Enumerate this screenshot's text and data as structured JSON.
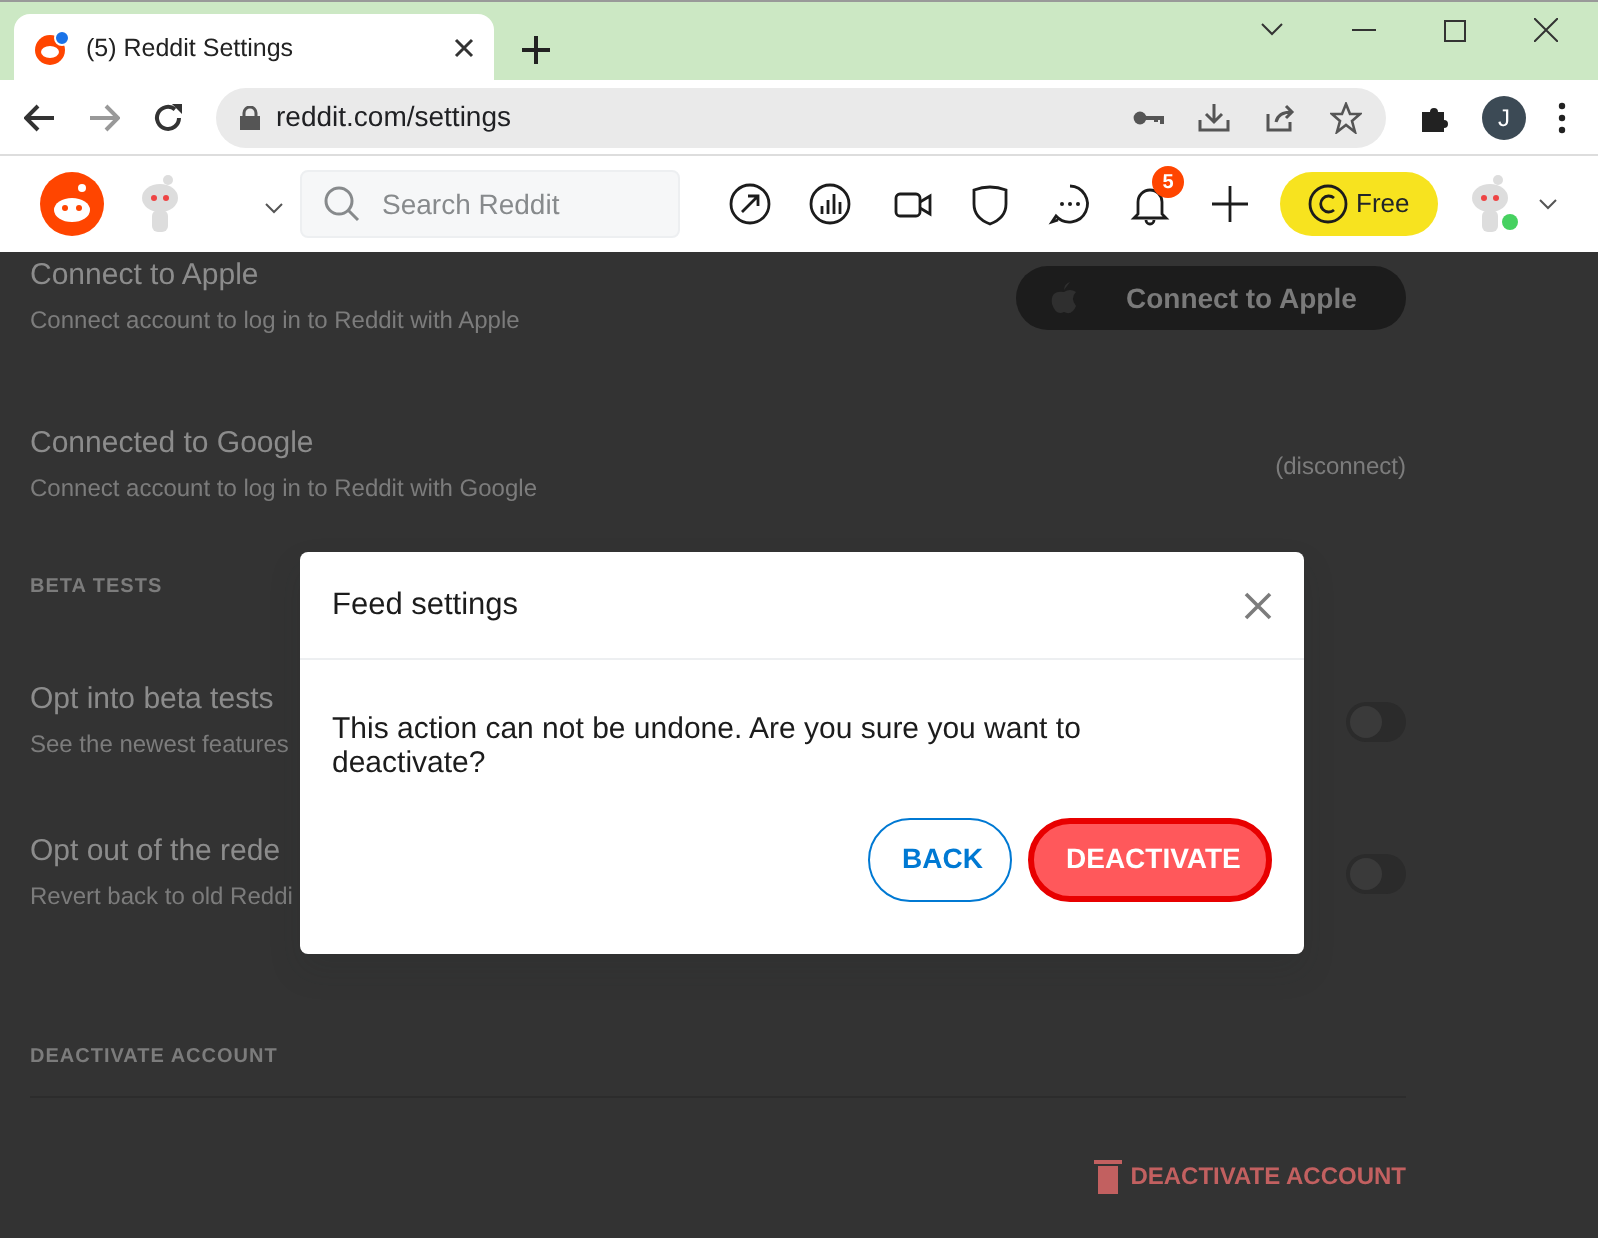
{
  "browser": {
    "tab": {
      "title": "(5) Reddit Settings",
      "has_notification": true
    },
    "url": "reddit.com/settings",
    "profile_initial": "J"
  },
  "header": {
    "search": {
      "placeholder": "Search Reddit"
    },
    "notification_count": "5",
    "coins_label": "Free",
    "online": true
  },
  "settings": [
    {
      "kind": "connect",
      "title": "Connect to Apple",
      "description": "Connect account to log in to Reddit with Apple",
      "action": "Connect to Apple"
    },
    {
      "kind": "link",
      "title": "Connected to Google",
      "description": "Connect account to log in to Reddit with Google",
      "action": "(disconnect)"
    },
    {
      "kind": "section",
      "title": "BETA TESTS"
    },
    {
      "kind": "toggle",
      "title": "Opt into beta tests",
      "description": "See the newest features",
      "on": false
    },
    {
      "kind": "toggle",
      "title": "Opt out of the rede",
      "description": "Revert back to old Reddi",
      "on": false
    },
    {
      "kind": "section",
      "title": "DEACTIVATE ACCOUNT"
    },
    {
      "kind": "danger",
      "action": "DEACTIVATE ACCOUNT"
    }
  ],
  "modal": {
    "title": "Feed settings",
    "message": "This action can not be undone. Are you sure you want to deactivate?",
    "buttons": [
      {
        "label": "BACK",
        "kind": "secondary"
      },
      {
        "label": "DEACTIVATE",
        "kind": "danger"
      }
    ]
  }
}
